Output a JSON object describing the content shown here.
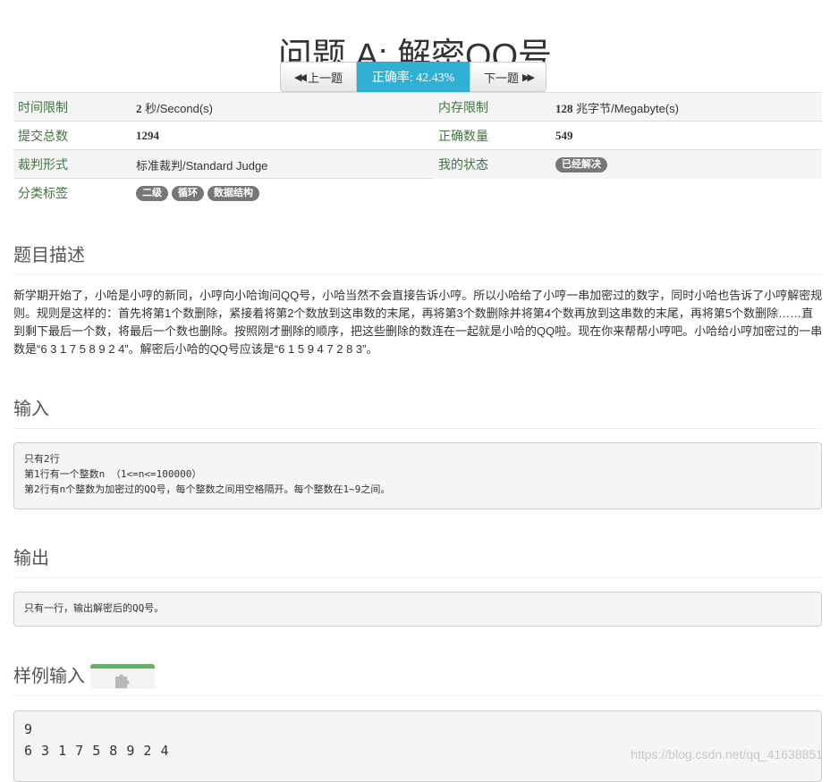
{
  "title": "问题 A: 解密QQ号",
  "nav": {
    "prev_label": "上一题",
    "accuracy_label": "正确率: 42.43%",
    "next_label": "下一题"
  },
  "info": {
    "time_limit_label": "时间限制",
    "time_limit_num": "2",
    "time_limit_unit": "秒/Second(s)",
    "memory_limit_label": "内存限制",
    "memory_limit_num": "128",
    "memory_limit_unit": "兆字节/Megabyte(s)",
    "submissions_label": "提交总数",
    "submissions_value": "1294",
    "accepted_label": "正确数量",
    "accepted_value": "549",
    "judge_label": "裁判形式",
    "judge_value": "标准裁判/Standard Judge",
    "status_label": "我的状态",
    "status_value": "已经解决",
    "tags_label": "分类标签",
    "tags": [
      "二级",
      "循环",
      "数据结构"
    ]
  },
  "description": {
    "heading": "题目描述",
    "text": "新学期开始了，小哈是小哼的新同，小哼向小哈询问QQ号，小哈当然不会直接告诉小哼。所以小哈给了小哼一串加密过的数字，同时小哈也告诉了小哼解密规则。规则是这样的：首先将第1个数删除，紧接着将第2个数放到这串数的末尾，再将第3个数删除并将第4个数再放到这串数的末尾，再将第5个数删除……直到剩下最后一个数，将最后一个数也删除。按照刚才删除的顺序，把这些删除的数连在一起就是小哈的QQ啦。现在你来帮帮小哼吧。小哈给小哼加密过的一串数是“6 3 1 7 5 8 9 2 4”。解密后小哈的QQ号应该是“6 1 5 9 4 7 2 8 3”。"
  },
  "input": {
    "heading": "输入",
    "lines": [
      "只有2行",
      "第1行有一个整数n （1<=n<=100000）",
      "第2行有n个整数为加密过的QQ号，每个整数之间用空格隔开。每个整数在1~9之间。"
    ]
  },
  "output": {
    "heading": "输出",
    "lines": [
      "只有一行，输出解密后的QQ号。"
    ]
  },
  "sample_input": {
    "heading": "样例输入",
    "copy_icon": "puzzle-icon",
    "lines": [
      "9",
      "6 3 1 7 5 8 9 2 4"
    ]
  },
  "watermark": "https://blog.csdn.net/qq_41638851",
  "colors": {
    "accent_info": "#31b0d5",
    "label_green": "#3c763d",
    "badge_gray": "#777777",
    "copy_green": "#5cb85c"
  }
}
